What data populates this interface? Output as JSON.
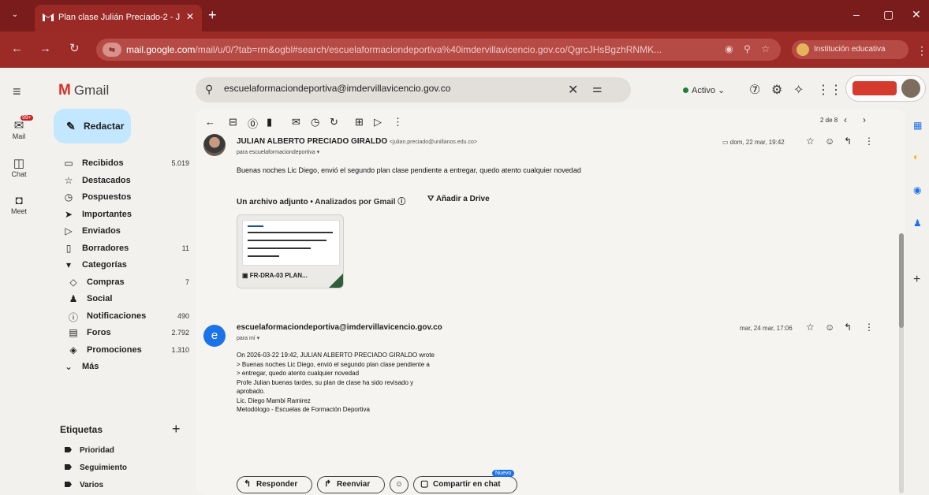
{
  "browser": {
    "tab_title": "Plan clase Julián Preciado-2 - J",
    "tab_close": "✕",
    "new_tab": "+",
    "url_host": "mail.google.com",
    "url_path": "/mail/u/0/?tab=rm&ogbl#search/escuelaformaciondeportiva%40imdervillavicencio.gov.co/QgrcJHsBgzhRNMK...",
    "profile_label": "Institución educativa"
  },
  "gmail": {
    "product_name": "Gmail",
    "search": {
      "value": "escuelaformaciondeportiva@imdervillavicencio.gov.co"
    },
    "status": "Activo",
    "rail": {
      "mail_label": "Mail",
      "mail_badge": "99+",
      "chat_label": "Chat",
      "meet_label": "Meet"
    },
    "compose_label": "Redactar",
    "nav": [
      {
        "icon": "inbox-icon",
        "glyph": "▭",
        "label": "Recibidos",
        "count": "5.019"
      },
      {
        "icon": "star-icon",
        "glyph": "☆",
        "label": "Destacados",
        "count": ""
      },
      {
        "icon": "clock-icon",
        "glyph": "◷",
        "label": "Pospuestos",
        "count": ""
      },
      {
        "icon": "important-icon",
        "glyph": "➤",
        "label": "Importantes",
        "count": ""
      },
      {
        "icon": "send-icon",
        "glyph": "▷",
        "label": "Enviados",
        "count": ""
      },
      {
        "icon": "draft-icon",
        "glyph": "▯",
        "label": "Borradores",
        "count": "11"
      },
      {
        "icon": "category-icon",
        "glyph": "▾",
        "label": "Categorías",
        "count": ""
      },
      {
        "icon": "tag-icon",
        "glyph": "◇",
        "label": "Compras",
        "count": "7",
        "sub": true
      },
      {
        "icon": "people-icon",
        "glyph": "♟",
        "label": "Social",
        "count": "",
        "sub": true
      },
      {
        "icon": "info-icon",
        "glyph": "ⓘ",
        "label": "Notificaciones",
        "count": "490",
        "sub": true
      },
      {
        "icon": "forum-icon",
        "glyph": "▤",
        "label": "Foros",
        "count": "2.792",
        "sub": true
      },
      {
        "icon": "promo-icon",
        "glyph": "◈",
        "label": "Promociones",
        "count": "1.310",
        "sub": true
      },
      {
        "icon": "chevron-down-icon",
        "glyph": "⌄",
        "label": "Más",
        "count": ""
      }
    ],
    "labels_header": "Etiquetas",
    "labels": [
      "Prioridad",
      "Seguimiento",
      "Varios"
    ],
    "thread": {
      "pager": "2 de 8",
      "message1": {
        "sender_name": "JULIAN ALBERTO PRECIADO GIRALDO",
        "sender_email": "<julian.preciado@unillanos.edu.co>",
        "to": "para escuelaformaciondeportiva",
        "time": "dom, 22 mar, 19:42",
        "body": "Buenas noches Lic Diego, envió el segundo plan clase pendiente a entregar, quedo atento cualquier novedad",
        "attachments_header": "Un archivo adjunto",
        "scanned_by": "Analizados por Gmail",
        "add_to_drive": "Añadir a Drive",
        "attachment_name": "FR-DRA-03 PLAN..."
      },
      "message2": {
        "avatar_letter": "e",
        "sender_email": "escuelaformaciondeportiva@imdervillavicencio.gov.co",
        "to": "para mí",
        "time": "mar, 24 mar, 17:06",
        "body_lines": [
          "On 2026-03-22 19:42, JULIAN ALBERTO PRECIADO GIRALDO wrote",
          "> Buenas noches Lic Diego, envió el segundo plan clase pendiente a",
          "> entregar, quedo atento cualquier novedad",
          "Profe Julian buenas tardes, su plan de clase ha sido revisado y",
          "aprobado.",
          "Lic. Diego Mambi Ramirez",
          "Metodólogo - Escuelas de Formación Deportiva"
        ]
      },
      "reply_label": "Responder",
      "forward_label": "Reenviar",
      "share_chat_label": "Compartir en chat",
      "new_badge": "Nuevo"
    }
  },
  "colors": {
    "browser_frame": "#7a1c1c",
    "toolbar": "#9c2b27",
    "compose": "#c2e7ff",
    "gmail_red": "#d93025",
    "avatar_blue": "#1a73e8"
  }
}
